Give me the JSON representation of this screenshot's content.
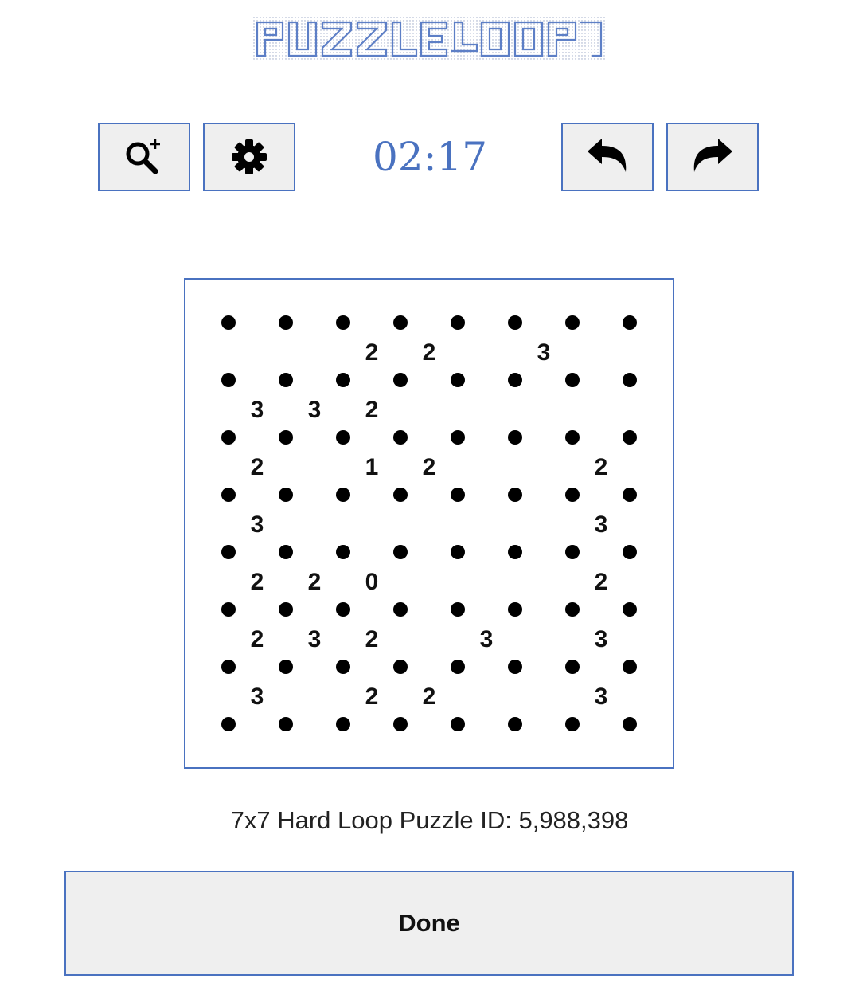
{
  "header": {
    "logo_text": "PUZZLE LOOP"
  },
  "toolbar": {
    "zoom_icon": "zoom-in-icon",
    "settings_icon": "gear-icon",
    "undo_icon": "undo-icon",
    "redo_icon": "redo-icon"
  },
  "timer": {
    "value": "02:17"
  },
  "board": {
    "rows": 7,
    "cols": 7,
    "clues": [
      [
        "",
        "",
        "2",
        "2",
        "",
        "3",
        ""
      ],
      [
        "3",
        "3",
        "2",
        "",
        "",
        "",
        ""
      ],
      [
        "2",
        "",
        "1",
        "2",
        "",
        "",
        "2"
      ],
      [
        "3",
        "",
        "",
        "",
        "",
        "",
        "3"
      ],
      [
        "2",
        "2",
        "0",
        "",
        "",
        "",
        "2"
      ],
      [
        "2",
        "3",
        "2",
        "",
        "3",
        "",
        "3"
      ],
      [
        "3",
        "",
        "2",
        "2",
        "",
        "",
        "3"
      ]
    ]
  },
  "info": {
    "puzzle_label": "7x7 Hard Loop Puzzle ID: 5,988,398"
  },
  "actions": {
    "done_label": "Done"
  },
  "colors": {
    "accent": "#4a72c0",
    "button_bg": "#efefef",
    "dot": "#000000"
  }
}
